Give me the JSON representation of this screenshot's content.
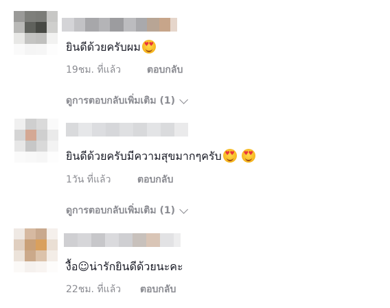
{
  "comments": [
    {
      "text": "ยินดีด้วยครับผม",
      "emoji_icons": [
        "smiling-face-with-hearts-icon"
      ],
      "time": "19ชม. ที่แล้ว",
      "reply_label": "ตอบกลับ",
      "view_more_label": "ดูการตอบกลับเพิ่มเติม (1)"
    },
    {
      "text": "ยินดีด้วยครับมีความสุขมากๆครับ",
      "emoji_icons": [
        "smiling-face-with-hearts-icon",
        "smiling-face-with-hearts-icon"
      ],
      "time": "1วัน ที่แล้ว",
      "reply_label": "ตอบกลับ",
      "view_more_label": "ดูการตอบกลับเพิ่มเติม (1)"
    },
    {
      "text": "งื้อ☺น่ารักยินดีด้วยนะคะ",
      "emoji_icons": [],
      "time": "22ชม. ที่แล้ว",
      "reply_label": "ตอบกลับ"
    }
  ],
  "icons": {
    "expand": "chevron-down-icon"
  }
}
